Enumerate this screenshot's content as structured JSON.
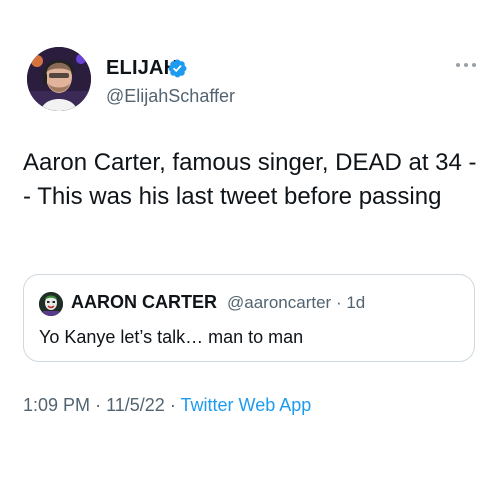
{
  "author": {
    "display_name": "ELIJAH",
    "handle": "@ElijahSchaffer",
    "verified": true
  },
  "tweet": {
    "text": "Aaron Carter, famous singer, DEAD at 34 -- This was his last tweet before passing"
  },
  "quoted_tweet": {
    "display_name": "AARON CARTER",
    "handle": "@aaroncarter",
    "separator": "·",
    "age": "1d",
    "text": "Yo Kanye let’s talk… man to man"
  },
  "footer": {
    "time": "1:09 PM",
    "separator": "·",
    "date": "11/5/22",
    "source": "Twitter Web App"
  },
  "colors": {
    "text": "#0f1419",
    "secondary": "#536471",
    "accent": "#1d9bf0",
    "border": "#cfd9de"
  },
  "icons": {
    "verified": "verified-badge-icon",
    "more": "more-options-icon"
  }
}
